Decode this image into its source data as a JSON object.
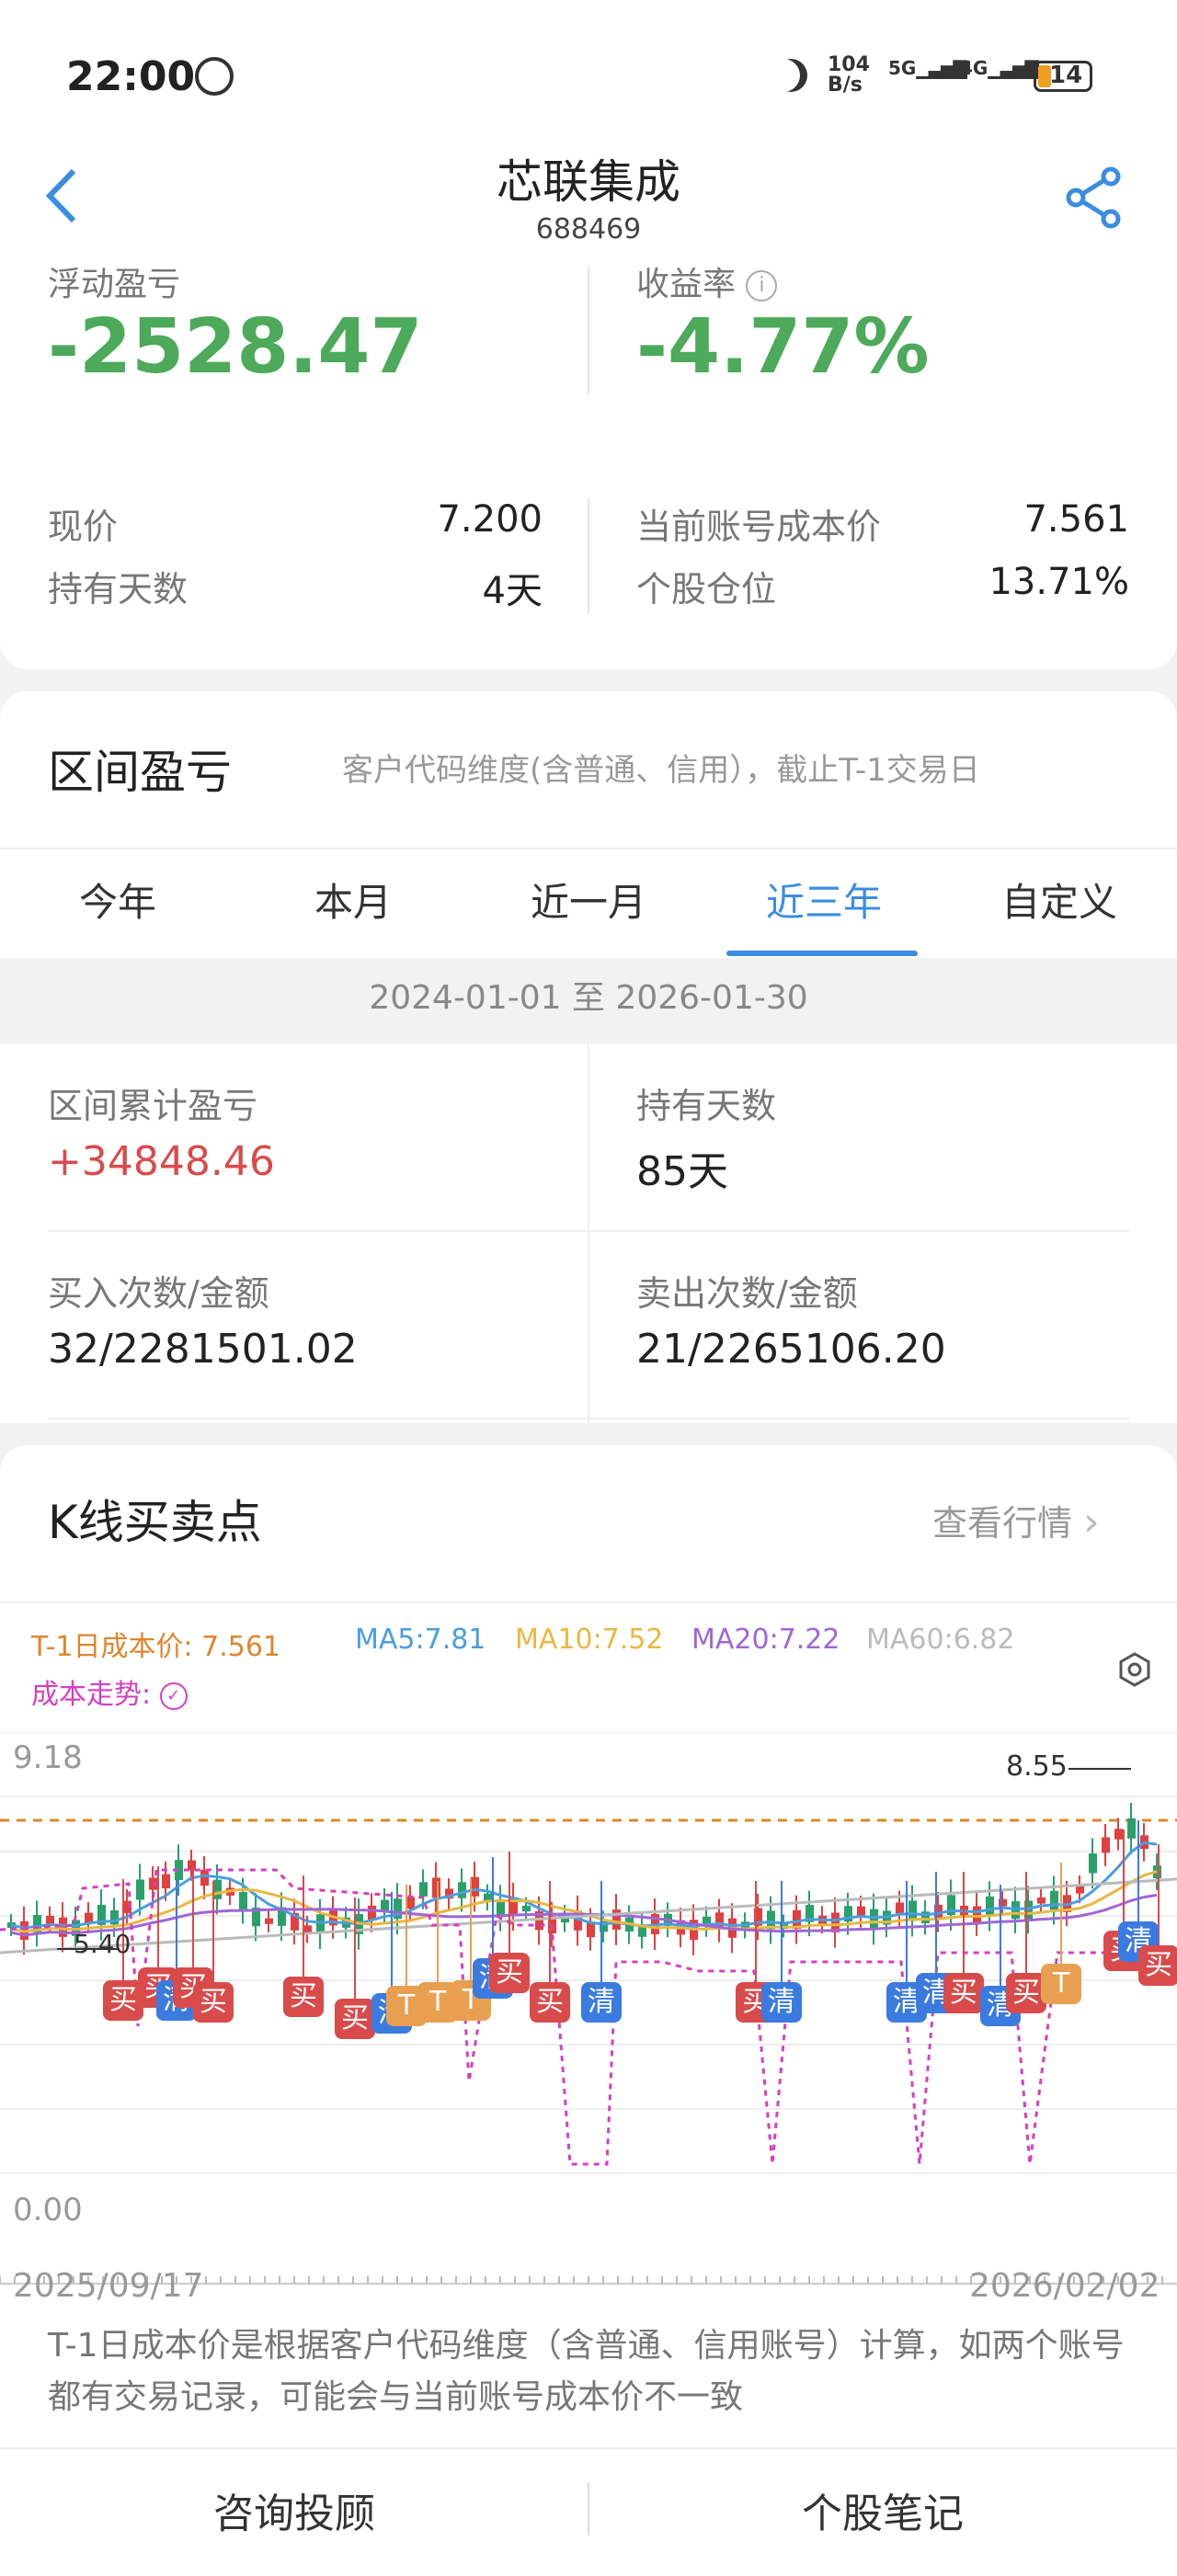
{
  "status": {
    "time": "22:00",
    "net_speed_top": "104",
    "net_speed_bottom": "B/s",
    "sig1": "5G",
    "sig2": "4G",
    "battery": "14"
  },
  "header": {
    "title": "芯联集成",
    "code": "688469"
  },
  "summary": {
    "float_pl_label": "浮动盈亏",
    "float_pl_value": "-2528.47",
    "yield_label": "收益率",
    "yield_value": "-4.77%",
    "price_label": "现价",
    "price_value": "7.200",
    "cost_label": "当前账号成本价",
    "cost_value": "7.561",
    "days_label": "持有天数",
    "days_value": "4天",
    "position_label": "个股仓位",
    "position_value": "13.71%"
  },
  "range": {
    "title": "区间盈亏",
    "note": "客户代码维度(含普通、信用），截止T-1交易日",
    "tabs": [
      {
        "label": "今年"
      },
      {
        "label": "本月"
      },
      {
        "label": "近一月"
      },
      {
        "label": "近三年"
      },
      {
        "label": "自定义"
      }
    ],
    "date_range": "2024-01-01 至 2026-01-30",
    "cum_pl_label": "区间累计盈亏",
    "cum_pl_value": "+34848.46",
    "hold_days_label": "持有天数",
    "hold_days_value": "85天",
    "buy_label": "买入次数/金额",
    "buy_value": "32/2281501.02",
    "sell_label": "卖出次数/金额",
    "sell_value": "21/2265106.20"
  },
  "kline": {
    "title": "K线买卖点",
    "view_link": "查看行情",
    "cost_line": "T-1日成本价: 7.561",
    "ma5": "MA5:7.81",
    "ma10": "MA10:7.52",
    "ma20": "MA20:7.22",
    "ma60": "MA60:6.82",
    "cost_trend": "成本走势:",
    "y_max": "9.18",
    "y_min": "0.00",
    "high_label": "8.55",
    "low_label": "5.40",
    "x_start": "2025/09/17",
    "x_end": "2026/02/02",
    "colors": {
      "cost": "#e0862a",
      "ma5": "#4a9ee0",
      "ma10": "#e8b840",
      "ma20": "#a066d8",
      "ma60": "#bbbbbb",
      "trend": "#d63fc0"
    },
    "tag_buy": "买",
    "tag_clear": "清",
    "tag_t": "T",
    "footnote": "T-1日成本价是根据客户代码维度（含普通、信用账号）计算，如两个账号都有交易记录，可能会与当前账号成本价不一致"
  },
  "bottom": {
    "consult": "咨询投顾",
    "notes": "个股笔记"
  }
}
